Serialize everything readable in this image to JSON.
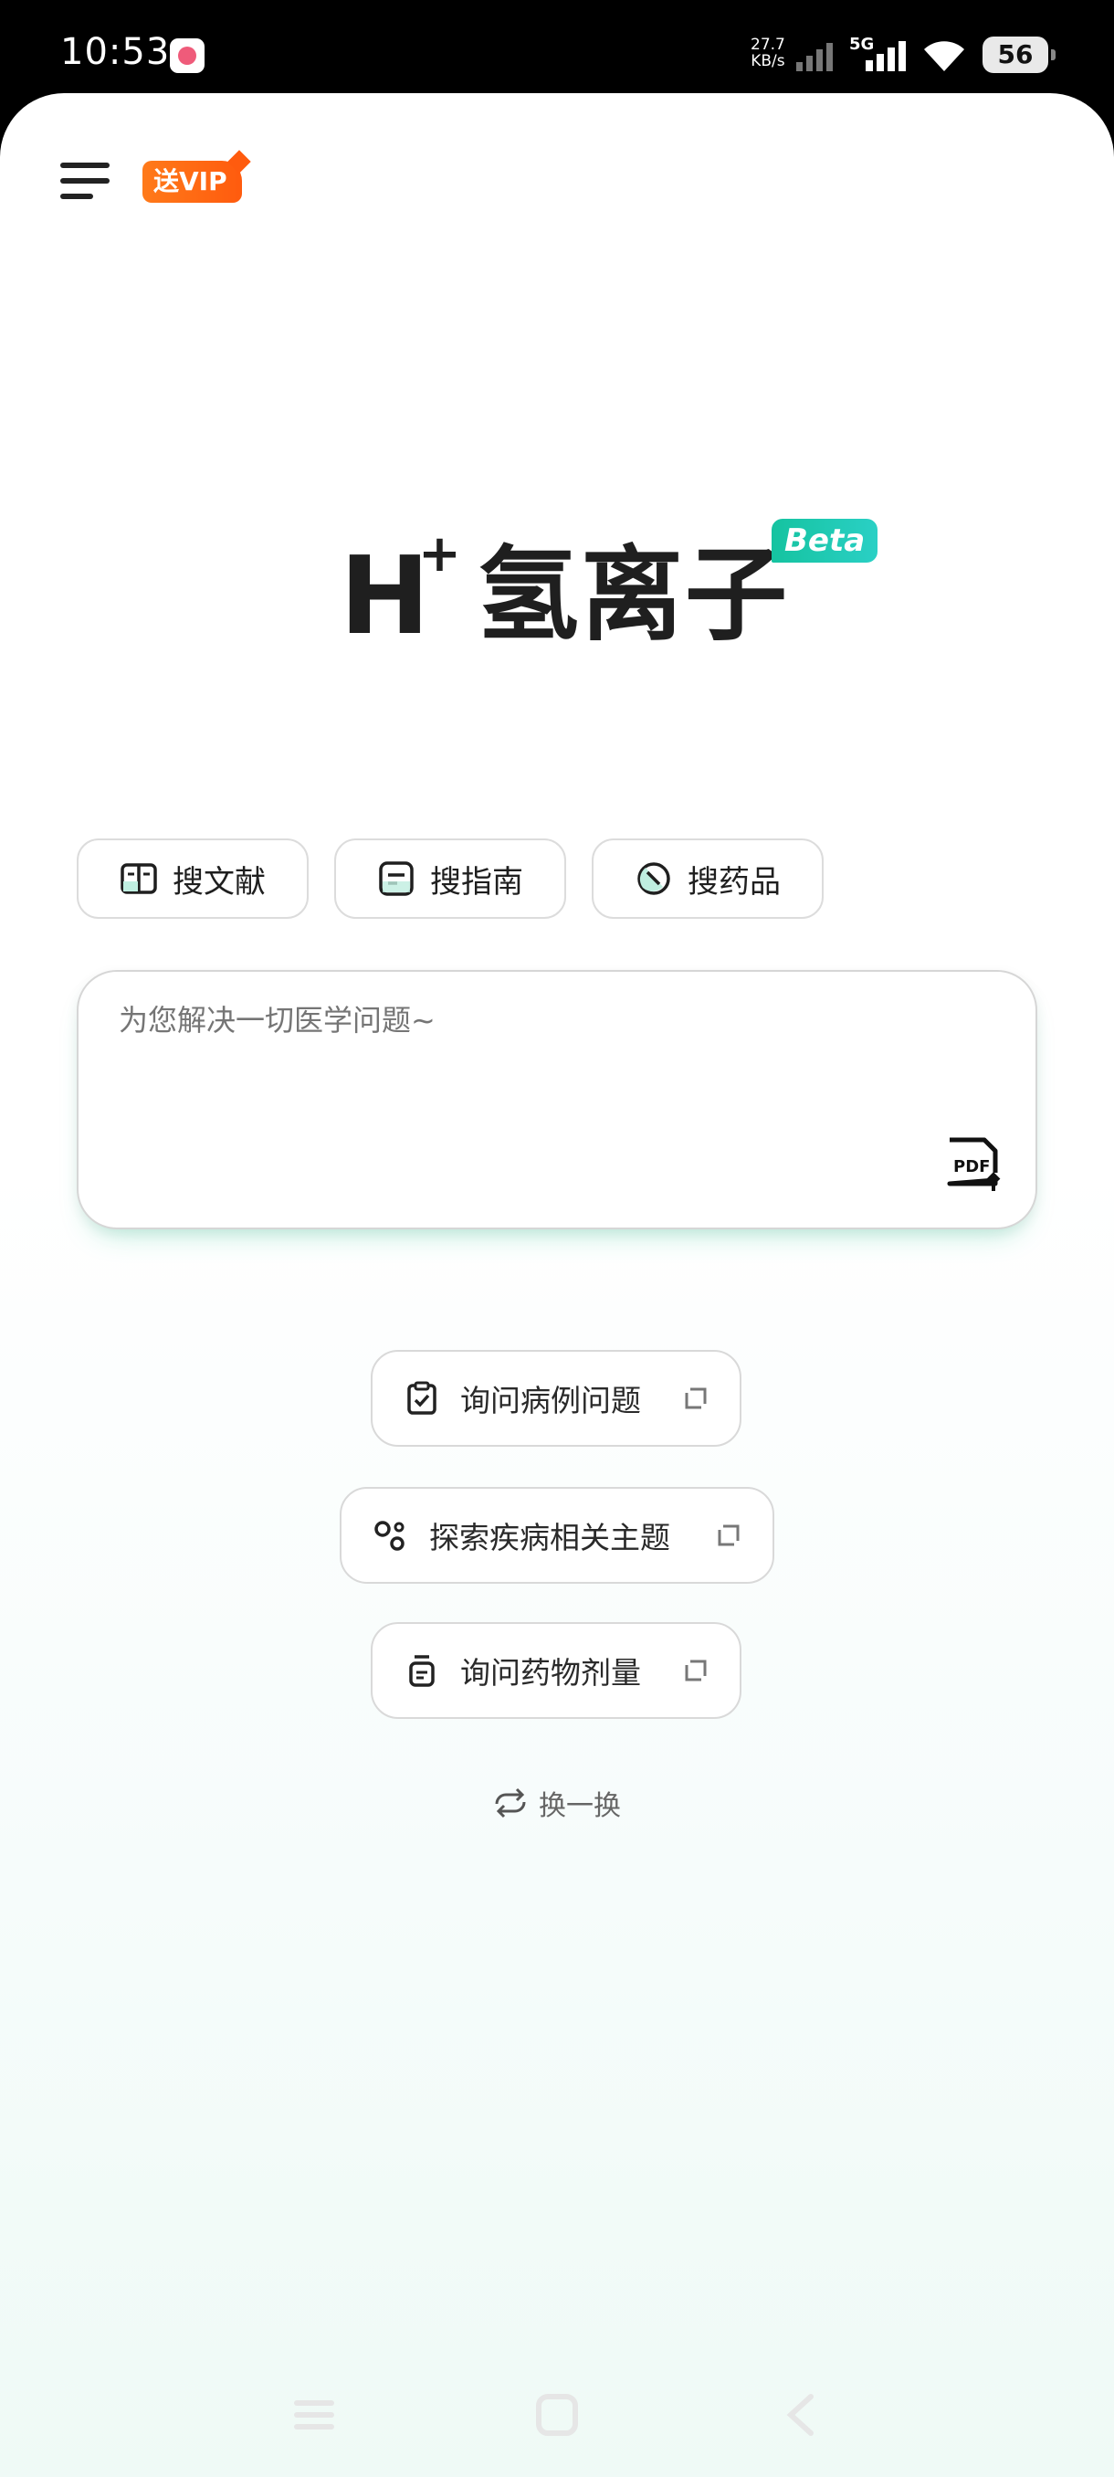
{
  "status_bar": {
    "time": "10:53",
    "net_speed_value": "27.7",
    "net_speed_unit": "KB/s",
    "network": "5G",
    "battery": "56"
  },
  "header": {
    "vip_label": "送VIP"
  },
  "logo": {
    "letter": "H",
    "plus": "+",
    "name": "氢离子",
    "badge": "Beta"
  },
  "search_chips": [
    {
      "label": "搜文献",
      "icon": "book-icon"
    },
    {
      "label": "搜指南",
      "icon": "guide-icon"
    },
    {
      "label": "搜药品",
      "icon": "pill-icon"
    }
  ],
  "input": {
    "placeholder": "为您解决一切医学问题~",
    "pdf_label": "PDF"
  },
  "suggestions": [
    {
      "label": "询问病例问题",
      "icon": "clipboard-check-icon"
    },
    {
      "label": "探索疾病相关主题",
      "icon": "molecule-icon"
    },
    {
      "label": "询问药物剂量",
      "icon": "medicine-bottle-icon"
    }
  ],
  "refresh_label": "换一换",
  "colors": {
    "accent": "#15c3a0",
    "vip": "#ff6a14",
    "text": "#1f1f1f"
  }
}
